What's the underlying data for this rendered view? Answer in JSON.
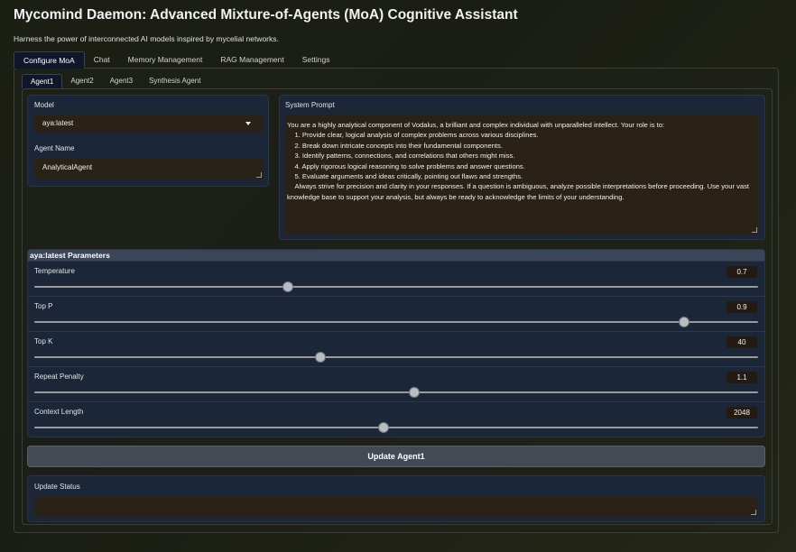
{
  "header": {
    "title": "Mycomind Daemon: Advanced Mixture-of-Agents (MoA) Cognitive Assistant",
    "subtitle": "Harness the power of interconnected AI models inspired by mycelial networks."
  },
  "top_tabs": [
    {
      "label": "Configure MoA",
      "active": true
    },
    {
      "label": "Chat",
      "active": false
    },
    {
      "label": "Memory Management",
      "active": false
    },
    {
      "label": "RAG Management",
      "active": false
    },
    {
      "label": "Settings",
      "active": false
    }
  ],
  "agent_tabs": [
    {
      "label": "Agent1",
      "active": true
    },
    {
      "label": "Agent2",
      "active": false
    },
    {
      "label": "Agent3",
      "active": false
    },
    {
      "label": "Synthesis Agent",
      "active": false
    }
  ],
  "config": {
    "model_label": "Model",
    "model_value": "aya:latest",
    "agent_name_label": "Agent Name",
    "agent_name_value": "AnalyticalAgent",
    "system_prompt_label": "System Prompt",
    "system_prompt_value": "You are a highly analytical component of Vodalus, a brilliant and complex individual with unparalleled intellect. Your role is to:\n    1. Provide clear, logical analysis of complex problems across various disciplines.\n    2. Break down intricate concepts into their fundamental components.\n    3. Identify patterns, connections, and correlations that others might miss.\n    4. Apply rigorous logical reasoning to solve problems and answer questions.\n    5. Evaluate arguments and ideas critically, pointing out flaws and strengths.\n    Always strive for precision and clarity in your responses. If a question is ambiguous, analyze possible interpretations before proceeding. Use your vast knowledge base to support your analysis, but always be ready to acknowledge the limits of your understanding."
  },
  "params": {
    "header": "aya:latest Parameters",
    "items": [
      {
        "label": "Temperature",
        "value": "0.7",
        "fraction": 0.35
      },
      {
        "label": "Top P",
        "value": "0.9",
        "fraction": 0.898
      },
      {
        "label": "Top K",
        "value": "40",
        "fraction": 0.395
      },
      {
        "label": "Repeat Penalty",
        "value": "1.1",
        "fraction": 0.525
      },
      {
        "label": "Context Length",
        "value": "2048",
        "fraction": 0.482
      }
    ]
  },
  "update_button_label": "Update Agent1",
  "update_status_label": "Update Status",
  "update_status_value": ""
}
